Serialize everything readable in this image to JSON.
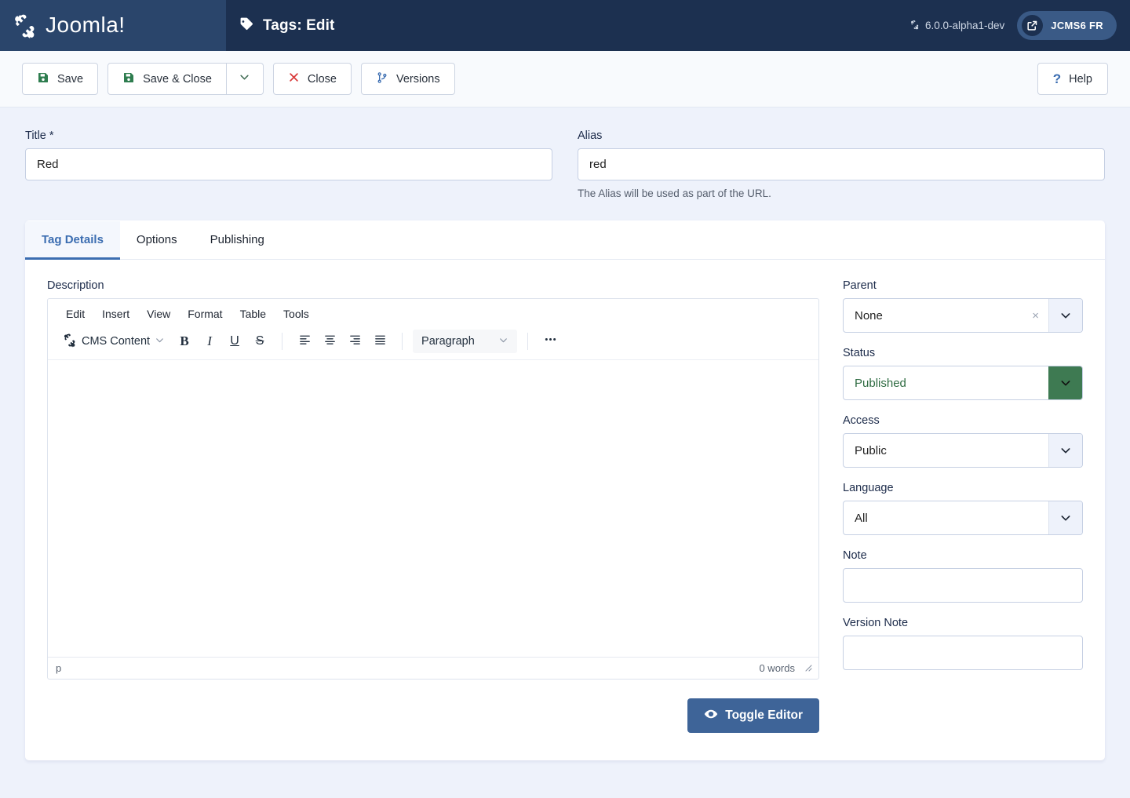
{
  "header": {
    "brand_name": "Joomla!",
    "brand_icon": "joomla-logo-icon",
    "page_title": "Tags: Edit",
    "page_title_icon": "tag-icon",
    "version_label": "6.0.0-alpha1-dev",
    "version_icon": "joomla-mark-icon",
    "site_button_label": "JCMS6 FR",
    "site_button_icon": "external-link-icon",
    "brand_bg": "#2a456b",
    "header_bg": "#1c3050"
  },
  "toolbar": {
    "save_label": "Save",
    "save_icon": "save-floppy-icon",
    "save_close_label": "Save & Close",
    "save_close_icon": "save-floppy-icon",
    "dropdown_icon": "chevron-down-icon",
    "close_label": "Close",
    "close_icon": "x-mark-icon",
    "versions_label": "Versions",
    "versions_icon": "git-branch-icon",
    "help_label": "Help",
    "help_icon": "question-mark-icon",
    "save_icon_color": "#2e7d4f",
    "close_icon_color": "#d93a3a",
    "versions_icon_color": "#3b6db1",
    "help_icon_color": "#3b6db1"
  },
  "form": {
    "title_label": "Title *",
    "title_value": "Red",
    "title_placeholder": "",
    "alias_label": "Alias",
    "alias_value": "red",
    "alias_placeholder": "",
    "alias_help": "The Alias will be used as part of the URL."
  },
  "tabs": [
    {
      "label": "Tag Details",
      "active": true
    },
    {
      "label": "Options",
      "active": false
    },
    {
      "label": "Publishing",
      "active": false
    }
  ],
  "editor": {
    "description_label": "Description",
    "menubar": [
      "Edit",
      "Insert",
      "View",
      "Format",
      "Table",
      "Tools"
    ],
    "cms_content_label": "CMS Content",
    "cms_content_icon": "joomla-mark-icon",
    "cms_content_caret": "chevron-down-icon",
    "bold_label": "B",
    "italic_label": "I",
    "underline_label": "U",
    "strike_label": "S",
    "align_icons": [
      "align-left-icon",
      "align-center-icon",
      "align-right-icon",
      "align-justify-icon"
    ],
    "block_format": "Paragraph",
    "more_icon": "ellipsis-icon",
    "status_path": "p",
    "word_count": "0 words",
    "resize_icon": "resize-handle-icon",
    "toggle_editor_label": "Toggle Editor",
    "toggle_editor_icon": "eye-icon",
    "toggle_editor_color": "#3e6498"
  },
  "sidebar": {
    "parent": {
      "label": "Parent",
      "value": "None",
      "clear_icon": "x-clear-icon",
      "caret_icon": "chevron-down-icon"
    },
    "status": {
      "label": "Status",
      "value": "Published",
      "caret_icon": "chevron-down-icon",
      "accent": "#3e7a52"
    },
    "access": {
      "label": "Access",
      "value": "Public",
      "caret_icon": "chevron-down-icon"
    },
    "language": {
      "label": "Language",
      "value": "All",
      "caret_icon": "chevron-down-icon"
    },
    "note": {
      "label": "Note",
      "value": "",
      "placeholder": ""
    },
    "version_note": {
      "label": "Version Note",
      "value": "",
      "placeholder": ""
    }
  }
}
